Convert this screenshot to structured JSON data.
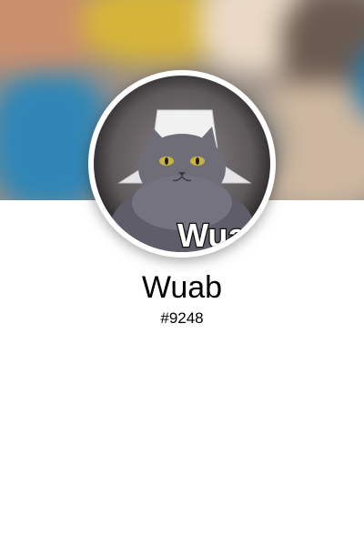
{
  "profile": {
    "username": "Wuab",
    "discriminator": "#9248",
    "avatar_caption": "Wua"
  },
  "colors": {
    "background": "#ffffff",
    "text": "#000000"
  }
}
